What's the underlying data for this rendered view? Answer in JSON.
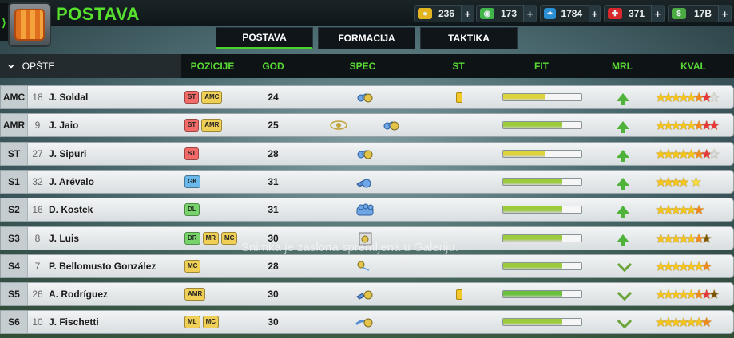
{
  "header": {
    "title": "POSTAVA",
    "menu_glyph": "⟩",
    "resources": [
      {
        "icon": "coin-icon",
        "symbol": "●",
        "value": "236",
        "color": "#e3b320"
      },
      {
        "icon": "cash-icon",
        "symbol": "◉",
        "value": "173",
        "color": "#3fb54a"
      },
      {
        "icon": "training-icon",
        "symbol": "✦",
        "value": "1784",
        "color": "#2b8fd6"
      },
      {
        "icon": "medical-icon",
        "symbol": "✚",
        "value": "371",
        "color": "#d8282b"
      },
      {
        "icon": "money-icon",
        "symbol": "$",
        "value": "17B",
        "color": "#4caa43"
      }
    ],
    "plus_label": "+"
  },
  "tabs": [
    {
      "label": "POSTAVA",
      "active": true
    },
    {
      "label": "FORMACIJA",
      "active": false
    },
    {
      "label": "TAKTIKA",
      "active": false
    }
  ],
  "columns": {
    "section": "OPŠTE",
    "section_chevron": "⌄",
    "pozicije": "POZICIJE",
    "god": "GOD",
    "spec": "SPEC",
    "st": "ST",
    "fit": "FIT",
    "mrl": "MRL",
    "kval": "KVAL"
  },
  "players": [
    {
      "pos": "AMC",
      "num": "18",
      "name": "J. Soldal",
      "tags": [
        [
          "ST",
          "fwd"
        ],
        [
          "AMC",
          "mid"
        ]
      ],
      "age": "24",
      "spec": [
        "group-icon"
      ],
      "card": true,
      "fit": 0.53,
      "fit_color": "#dcd43a",
      "mrl": "up",
      "stars": [
        "g",
        "g",
        "g",
        "g",
        "g",
        "o",
        "r",
        "e"
      ]
    },
    {
      "pos": "AMR",
      "num": "9",
      "name": "J. Jaio",
      "tags": [
        [
          "ST",
          "fwd"
        ],
        [
          "AMR",
          "mid"
        ]
      ],
      "age": "25",
      "spec": [
        "eye-icon",
        "group-icon"
      ],
      "card": false,
      "fit": 0.76,
      "fit_color": "#9ccc3c",
      "mrl": "up",
      "stars": [
        "g",
        "g",
        "g",
        "g",
        "g",
        "o",
        "r",
        "r"
      ]
    },
    {
      "pos": "ST",
      "num": "27",
      "name": "J. Sipuri",
      "tags": [
        [
          "ST",
          "fwd"
        ]
      ],
      "age": "28",
      "spec": [
        "group-icon"
      ],
      "card": false,
      "fit": 0.53,
      "fit_color": "#dcd43a",
      "mrl": "up",
      "stars": [
        "g",
        "g",
        "g",
        "g",
        "g",
        "o",
        "r",
        "e"
      ]
    },
    {
      "pos": "S1",
      "num": "32",
      "name": "J. Arévalo",
      "tags": [
        [
          "GK",
          "gk"
        ]
      ],
      "age": "31",
      "spec": [
        "dive-icon"
      ],
      "card": false,
      "fit": 0.76,
      "fit_color": "#9ccc3c",
      "mrl": "up",
      "stars": [
        "g",
        "g",
        "g",
        "g",
        "gb"
      ]
    },
    {
      "pos": "S2",
      "num": "16",
      "name": "D. Kostek",
      "tags": [
        [
          "DL",
          "def"
        ]
      ],
      "age": "31",
      "spec": [
        "wall-icon"
      ],
      "card": false,
      "fit": 0.76,
      "fit_color": "#9ccc3c",
      "mrl": "up",
      "stars": [
        "g",
        "g",
        "g",
        "g",
        "g",
        "o"
      ]
    },
    {
      "pos": "S3",
      "num": "8",
      "name": "J. Luis",
      "tags": [
        [
          "DR",
          "def"
        ],
        [
          "MR",
          "mid"
        ],
        [
          "MC",
          "mid"
        ]
      ],
      "age": "30",
      "spec": [
        "ball-icon"
      ],
      "card": false,
      "fit": 0.76,
      "fit_color": "#9ccc3c",
      "mrl": "up",
      "stars": [
        "g",
        "g",
        "g",
        "g",
        "g",
        "o",
        "h"
      ]
    },
    {
      "pos": "S4",
      "num": "7",
      "name": "P. Bellomusto González",
      "tags": [
        [
          "MC",
          "mid"
        ]
      ],
      "age": "28",
      "spec": [
        "pass-icon"
      ],
      "card": false,
      "fit": 0.76,
      "fit_color": "#9ccc3c",
      "mrl": "diag",
      "stars": [
        "g",
        "g",
        "g",
        "g",
        "g",
        "g",
        "o"
      ]
    },
    {
      "pos": "S5",
      "num": "26",
      "name": "A. Rodríguez",
      "tags": [
        [
          "AMR",
          "mid"
        ]
      ],
      "age": "30",
      "spec": [
        "shot-icon"
      ],
      "card": true,
      "fit": 0.76,
      "fit_color": "#6cc03e",
      "mrl": "diag",
      "stars": [
        "g",
        "g",
        "g",
        "g",
        "g",
        "o",
        "r",
        "h"
      ]
    },
    {
      "pos": "S6",
      "num": "10",
      "name": "J. Fischetti",
      "tags": [
        [
          "ML",
          "mid"
        ],
        [
          "MC",
          "mid"
        ]
      ],
      "age": "30",
      "spec": [
        "dribble-icon"
      ],
      "card": false,
      "fit": 0.76,
      "fit_color": "#9ccc3c",
      "mrl": "diag",
      "stars": [
        "g",
        "g",
        "g",
        "g",
        "g",
        "g",
        "o"
      ]
    }
  ],
  "toast": "Snimka je zaslona spremljena u Galeriju."
}
